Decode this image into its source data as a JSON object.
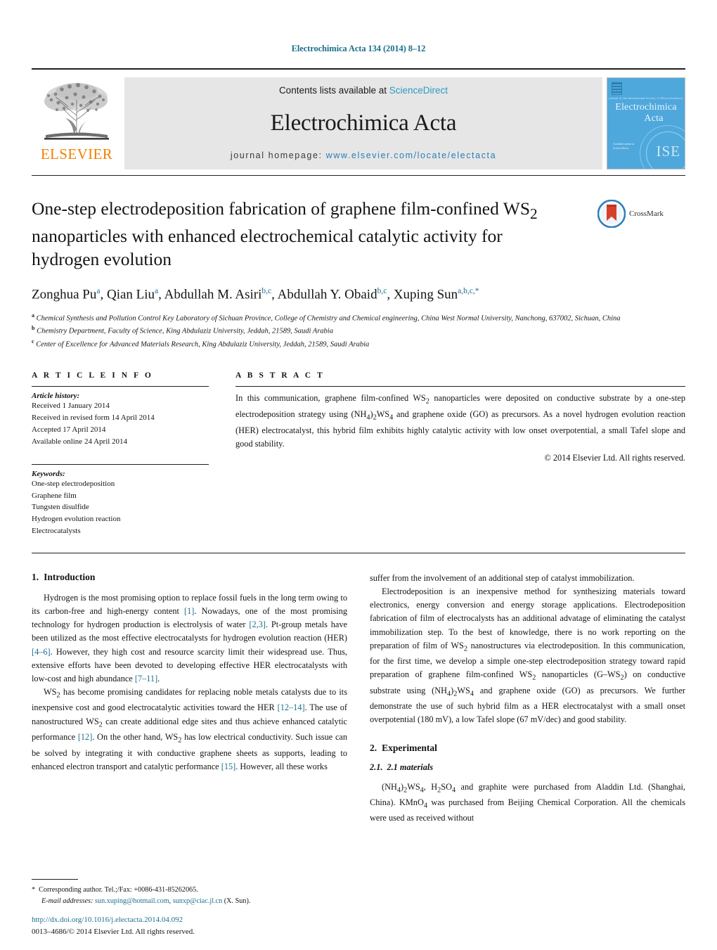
{
  "running_head": "Electrochimica Acta 134 (2014) 8–12",
  "masthead": {
    "publisher_name": "ELSEVIER",
    "contents_prefix": "Contents lists available at ",
    "contents_link": "ScienceDirect",
    "journal_name": "Electrochimica Acta",
    "homepage_label": "journal homepage:",
    "homepage_url": "www.elsevier.com/locate/electacta",
    "cover": {
      "subtitle": "journal of the International Society of Electrochemistry",
      "title_line1": "Electrochimica",
      "title_line2": "Acta",
      "foot_line1": "Available online at",
      "foot_line2": "ScienceDirect",
      "seal_text": "ISE"
    }
  },
  "article": {
    "title_part1": "One-step electrodeposition fabrication of graphene film-confined WS",
    "title_sub1": "2",
    "title_part2": " nanoparticles with enhanced electrochemical catalytic activity for hydrogen evolution",
    "crossmark_label": "CrossMark",
    "authors": [
      {
        "name": "Zonghua Pu",
        "marks": "a",
        "sep": ", "
      },
      {
        "name": "Qian Liu",
        "marks": "a",
        "sep": ", "
      },
      {
        "name": "Abdullah M. Asiri",
        "marks": "b,c",
        "sep": ", "
      },
      {
        "name": "Abdullah Y. Obaid",
        "marks": "b,c",
        "sep": ", "
      },
      {
        "name": "Xuping Sun",
        "marks": "a,b,c,*",
        "sep": ""
      }
    ],
    "affiliations": [
      {
        "mark": "a",
        "text": "Chemical Synthesis and Pollution Control Key Laboratory of Sichuan Province, College of Chemistry and Chemical engineering, China West Normal University, Nanchong, 637002, Sichuan, China"
      },
      {
        "mark": "b",
        "text": "Chemistry Department, Faculty of Science, King Abdulaziz University, Jeddah, 21589, Saudi Arabia"
      },
      {
        "mark": "c",
        "text": "Center of Excellence for Advanced Materials Research, King Abdulaziz University, Jeddah, 21589, Saudi Arabia"
      }
    ]
  },
  "article_info": {
    "heading": "A R T I C L E   I N F O",
    "history_label": "Article history:",
    "history": [
      "Received 1 January 2014",
      "Received in revised form 14 April 2014",
      "Accepted 17 April 2014",
      "Available online 24 April 2014"
    ],
    "keywords_label": "Keywords:",
    "keywords": [
      "One-step electrodeposition",
      "Graphene film",
      "Tungsten disulfide",
      "Hydrogen evolution reaction",
      "Electrocatalysts"
    ]
  },
  "abstract": {
    "heading": "A B S T R A C T",
    "text_1": "In this communication, graphene film-confined WS",
    "sub_1": "2",
    "text_2": " nanoparticles were deposited on conductive substrate by a one-step electrodeposition strategy using (NH",
    "sub_2": "4",
    "text_3": ")",
    "sub_3": "2",
    "text_4": "WS",
    "sub_4": "4",
    "text_5": " and graphene oxide (GO) as precursors. As a novel hydrogen evolution reaction (HER) electrocatalyst, this hybrid film exhibits highly catalytic activity with low onset overpotential, a small Tafel slope and good stability.",
    "copyright": "© 2014 Elsevier Ltd. All rights reserved."
  },
  "body": {
    "intro_num": "1.",
    "intro_title": "Introduction",
    "p1_a": "Hydrogen is the most promising option to replace fossil fuels in the long term owing to its carbon-free and high-energy content ",
    "p1_ref1": "[1]",
    "p1_b": ". Nowadays, one of the most promising technology for hydrogen production is electrolysis of water ",
    "p1_ref2": "[2,3]",
    "p1_c": ". Pt-group metals have been utilized as the most effective electrocatalysts for hydrogen evolution reaction (HER) ",
    "p1_ref3": "[4–6]",
    "p1_d": ". However, they high cost and resource scarcity limit their widespread use. Thus, extensive efforts have been devoted to developing effective HER electrocatalysts with low-cost and high abundance ",
    "p1_ref4": "[7–11]",
    "p1_e": ".",
    "p2_a": "WS",
    "p2_sub1": "2",
    "p2_b": " has become promising candidates for replacing noble metals catalysts due to its inexpensive cost and good electrocatalytic activities toward the HER ",
    "p2_ref1": "[12–14]",
    "p2_c": ". The use of nanostructured WS",
    "p2_sub2": "2",
    "p2_d": " can create additional edge sites and thus achieve enhanced catalytic performance ",
    "p2_ref2": "[12]",
    "p2_e": ". On the other hand, WS",
    "p2_sub3": "2",
    "p2_f": " has low electrical conductivity. Such issue can be solved by integrating it with conductive graphene sheets as supports, leading to enhanced electron transport and catalytic performance ",
    "p2_ref3": "[15]",
    "p2_g": ". However, all these works",
    "p3_continued": "suffer from the involvement of an additional step of catalyst immobilization.",
    "p4_a": "Electrodeposition is an inexpensive method for synthesizing materials toward electronics, energy conversion and energy storage applications. Electrodeposition fabrication of film of electrocalysts has an additional advatage of eliminating the catalyst immobilization step. To the best of knowledge, there is no work reporting on the preparation of film of WS",
    "p4_sub1": "2",
    "p4_b": " nanostructures via electrodeposition. In this communication, for the first time, we develop a simple one-step electrodeposition strategy toward rapid preparation of graphene film-confined WS",
    "p4_sub2": "2",
    "p4_c": " nanoparticles (G–WS",
    "p4_sub3": "2",
    "p4_d": ") on conductive substrate using (NH",
    "p4_sub4": "4",
    "p4_e": ")",
    "p4_sub5": "2",
    "p4_f": "WS",
    "p4_sub6": "4",
    "p4_g": " and graphene oxide (GO) as precursors. We further demonstrate the use of such hybrid film as a HER electrocatalyst with a small onset overpotential (180 mV), a low Tafel slope (67 mV/dec) and good stability.",
    "exp_num": "2.",
    "exp_title": "Experimental",
    "mat_num": "2.1.",
    "mat_title": "2.1 materials",
    "p5_a": "(NH",
    "p5_sub1": "4",
    "p5_b": ")",
    "p5_sub2": "2",
    "p5_c": "WS",
    "p5_sub3": "4",
    "p5_d": ", H",
    "p5_sub4": "2",
    "p5_e": "SO",
    "p5_sub5": "4",
    "p5_f": " and graphite were purchased from Aladdin Ltd. (Shanghai, China). KMnO",
    "p5_sub6": "4",
    "p5_g": " was purchased from Beijing Chemical Corporation. All the chemicals were used as received without"
  },
  "footer": {
    "corr_star": "*",
    "corr_text": "Corresponding author. Tel.;/Fax: +0086-431-85262065.",
    "email_label": "E-mail addresses:",
    "email_1": "sun.xuping@hotmail.com",
    "email_sep": ", ",
    "email_2": "sunxp@ciac.jl.cn",
    "email_suffix": " (X. Sun).",
    "doi": "http://dx.doi.org/10.1016/j.electacta.2014.04.092",
    "issn": "0013–4686/© 2014 Elsevier Ltd. All rights reserved."
  },
  "colors": {
    "link_blue": "#1b6f8c",
    "sciencedirect_blue": "#2a9ac4",
    "elsevier_orange": "#f08000",
    "cover_blue": "#4fa8dc",
    "band_gray": "#e6e6e6"
  }
}
